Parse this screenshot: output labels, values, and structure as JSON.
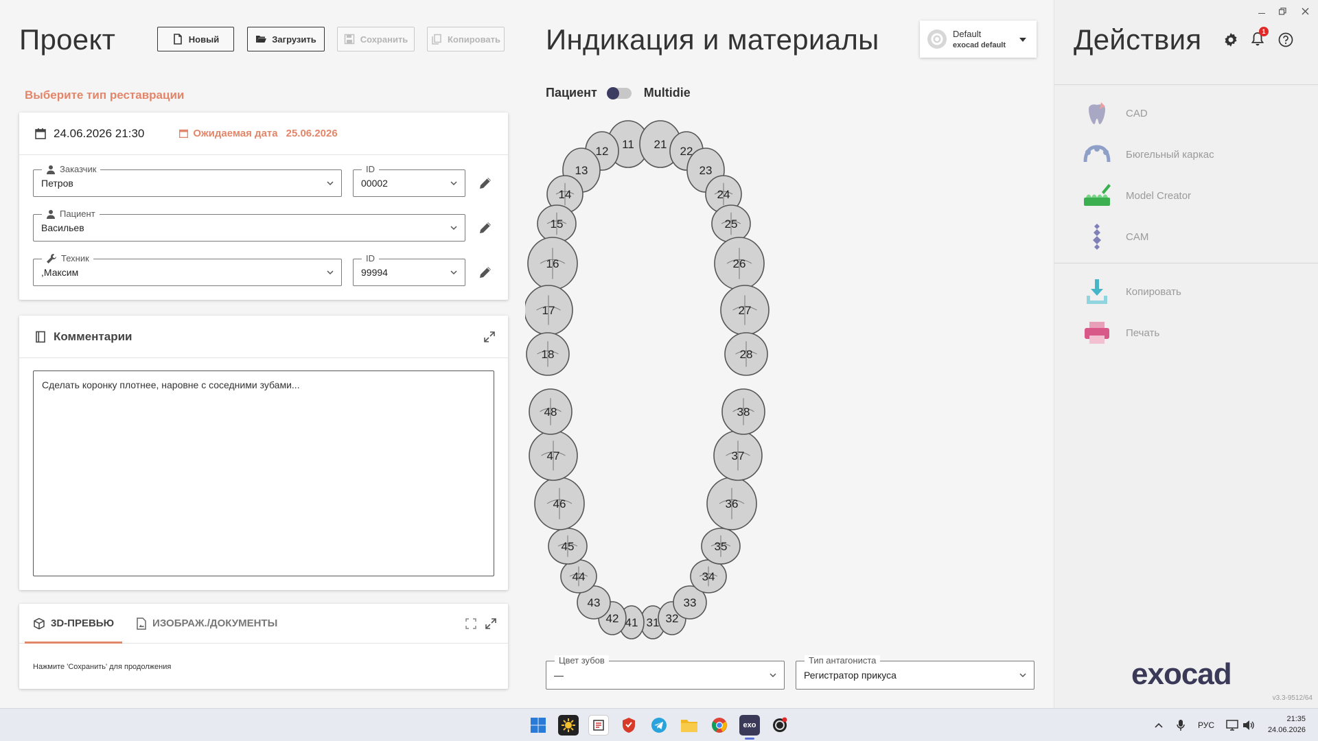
{
  "project": {
    "title": "Проект",
    "buttons": {
      "new": "Новый",
      "load": "Загрузить",
      "save": "Сохранить",
      "copy": "Копировать"
    },
    "restoration_link": "Выберите тип реставрации",
    "date": "24.06.2026 21:30",
    "due_label": "Ожидаемая дата",
    "due_value": "25.06.2026",
    "customer": {
      "label": "Заказчик",
      "value": "Петров"
    },
    "customer_id": {
      "label": "ID",
      "value": "00002"
    },
    "patient": {
      "label": "Пациент",
      "value": "Васильев"
    },
    "technician": {
      "label": "Техник",
      "value": ",Максим"
    },
    "technician_id": {
      "label": "ID",
      "value": "99994"
    }
  },
  "comments": {
    "title": "Комментарии",
    "text": "Сделать коронку плотнее, наровне с соседними зубами..."
  },
  "preview": {
    "tab_3d": "3D-ПРЕВЬЮ",
    "tab_docs": "ИЗОБРАЖ./ДОКУМЕНТЫ",
    "hint": "Нажмите 'Сохранить' для продолжения"
  },
  "indication": {
    "title": "Индикация и материалы",
    "toggle_left": "Пациент",
    "toggle_right": "Multidie",
    "profile": {
      "name": "Default",
      "sub": "exocad default"
    },
    "teeth": [
      "11",
      "12",
      "13",
      "14",
      "15",
      "16",
      "17",
      "18",
      "21",
      "22",
      "23",
      "24",
      "25",
      "26",
      "27",
      "28",
      "31",
      "32",
      "33",
      "34",
      "35",
      "36",
      "37",
      "38",
      "41",
      "42",
      "43",
      "44",
      "45",
      "46",
      "47",
      "48"
    ],
    "tooth_color": {
      "label": "Цвет зубов",
      "value": "—"
    },
    "antagonist": {
      "label": "Тип антагониста",
      "value": "Регистратор прикуса"
    }
  },
  "actions": {
    "title": "Действия",
    "notification_count": "1",
    "items": [
      {
        "label": "CAD",
        "icon": "cad-tooth-icon"
      },
      {
        "label": "Бюгельный каркас",
        "icon": "framework-icon"
      },
      {
        "label": "Model Creator",
        "icon": "model-creator-icon"
      },
      {
        "label": "CAM",
        "icon": "cam-icon"
      },
      {
        "label": "Копировать",
        "icon": "copy-download-icon"
      },
      {
        "label": "Печать",
        "icon": "print-icon"
      }
    ],
    "logo": "exocad",
    "version": "v3.3-9512/64"
  },
  "taskbar": {
    "lang": "РУС",
    "time": "21:35",
    "date": "24.06.2026"
  },
  "colors": {
    "accent": "#e2866a",
    "toggle_knob": "#3c3c62",
    "logo": "#3a3a58"
  }
}
